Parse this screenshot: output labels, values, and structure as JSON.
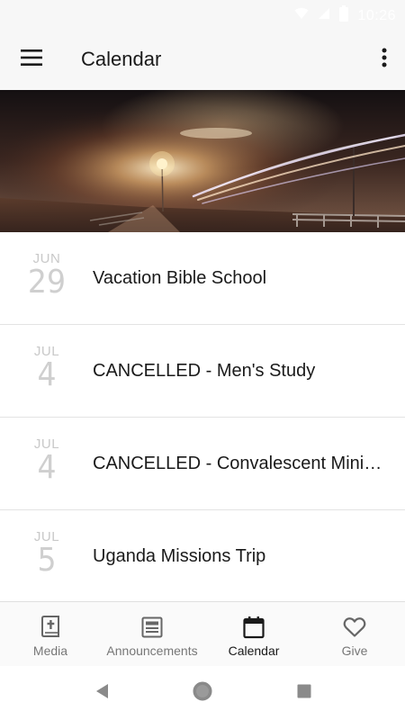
{
  "status_bar": {
    "time": "10:26"
  },
  "app_bar": {
    "title": "Calendar"
  },
  "events": [
    {
      "month": "JUN",
      "day": "29",
      "title": "Vacation Bible School"
    },
    {
      "month": "JUL",
      "day": "4",
      "title": "CANCELLED - Men's Study"
    },
    {
      "month": "JUL",
      "day": "4",
      "title": "CANCELLED - Convalescent Ministry"
    },
    {
      "month": "JUL",
      "day": "5",
      "title": "Uganda Missions Trip"
    }
  ],
  "bottom_nav": {
    "items": [
      {
        "label": "Media",
        "icon": "bible-icon"
      },
      {
        "label": "Announcements",
        "icon": "news-icon"
      },
      {
        "label": "Calendar",
        "icon": "calendar-icon"
      },
      {
        "label": "Give",
        "icon": "heart-icon"
      }
    ],
    "active": "Calendar"
  }
}
